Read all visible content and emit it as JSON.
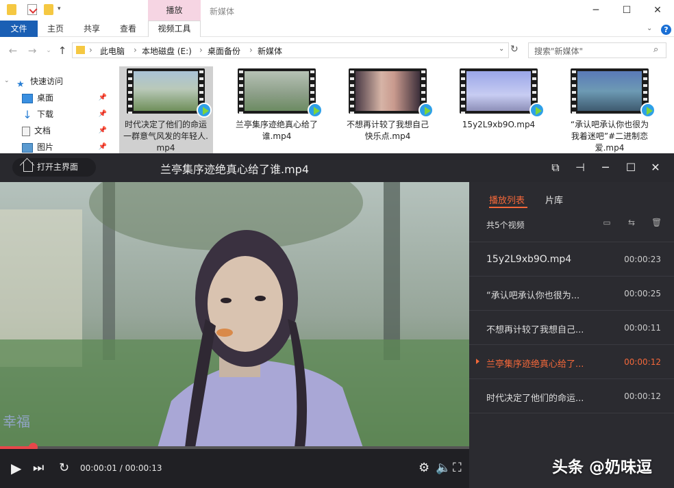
{
  "explorer": {
    "context_tab": "播放",
    "window_title": "新媒体",
    "ribbon_tabs": [
      "文件",
      "主页",
      "共享",
      "查看",
      "视频工具"
    ],
    "breadcrumbs": [
      "此电脑",
      "本地磁盘 (E:)",
      "桌面备份",
      "新媒体"
    ],
    "search_placeholder": "搜索\"新媒体\"",
    "nav": {
      "quick_access": "快速访问",
      "items": [
        "桌面",
        "下载",
        "文档",
        "图片"
      ]
    },
    "files": [
      {
        "name": "时代决定了他们的命运一群意气风发的年轻人.mp4",
        "selected": true
      },
      {
        "name": "兰亭集序迹绝真心给了谁.mp4"
      },
      {
        "name": "不想再计较了我想自己快乐点.mp4"
      },
      {
        "name": "15y2L9xb9O.mp4"
      },
      {
        "name": "“承认吧承认你也很为我着迷吧”#二进制恋爱.mp4"
      }
    ]
  },
  "player": {
    "home_button": "打开主界面",
    "title": "兰亭集序迹绝真心给了谁.mp4",
    "time_current": "00:00:01",
    "time_total": "00:00:13",
    "time_separator": " / ",
    "progress_fraction": 0.07,
    "video_subtitle": "幸福",
    "colors": {
      "accent": "#f5683a",
      "progress": "#e8474a",
      "bg": "#2b2b30"
    }
  },
  "playlist": {
    "tabs": [
      "播放列表",
      "片库"
    ],
    "count_label": "共5个视频",
    "items": [
      {
        "name": "15y2L9xb9O.mp4",
        "duration": "00:00:23"
      },
      {
        "name": "“承认吧承认你也很为...",
        "duration": "00:00:25"
      },
      {
        "name": "不想再计较了我想自己...",
        "duration": "00:00:11"
      },
      {
        "name": "兰亭集序迹绝真心给了...",
        "duration": "00:00:12",
        "active": true
      },
      {
        "name": "时代决定了他们的命运...",
        "duration": "00:00:12"
      }
    ]
  },
  "watermark": "头条 @奶味逗"
}
